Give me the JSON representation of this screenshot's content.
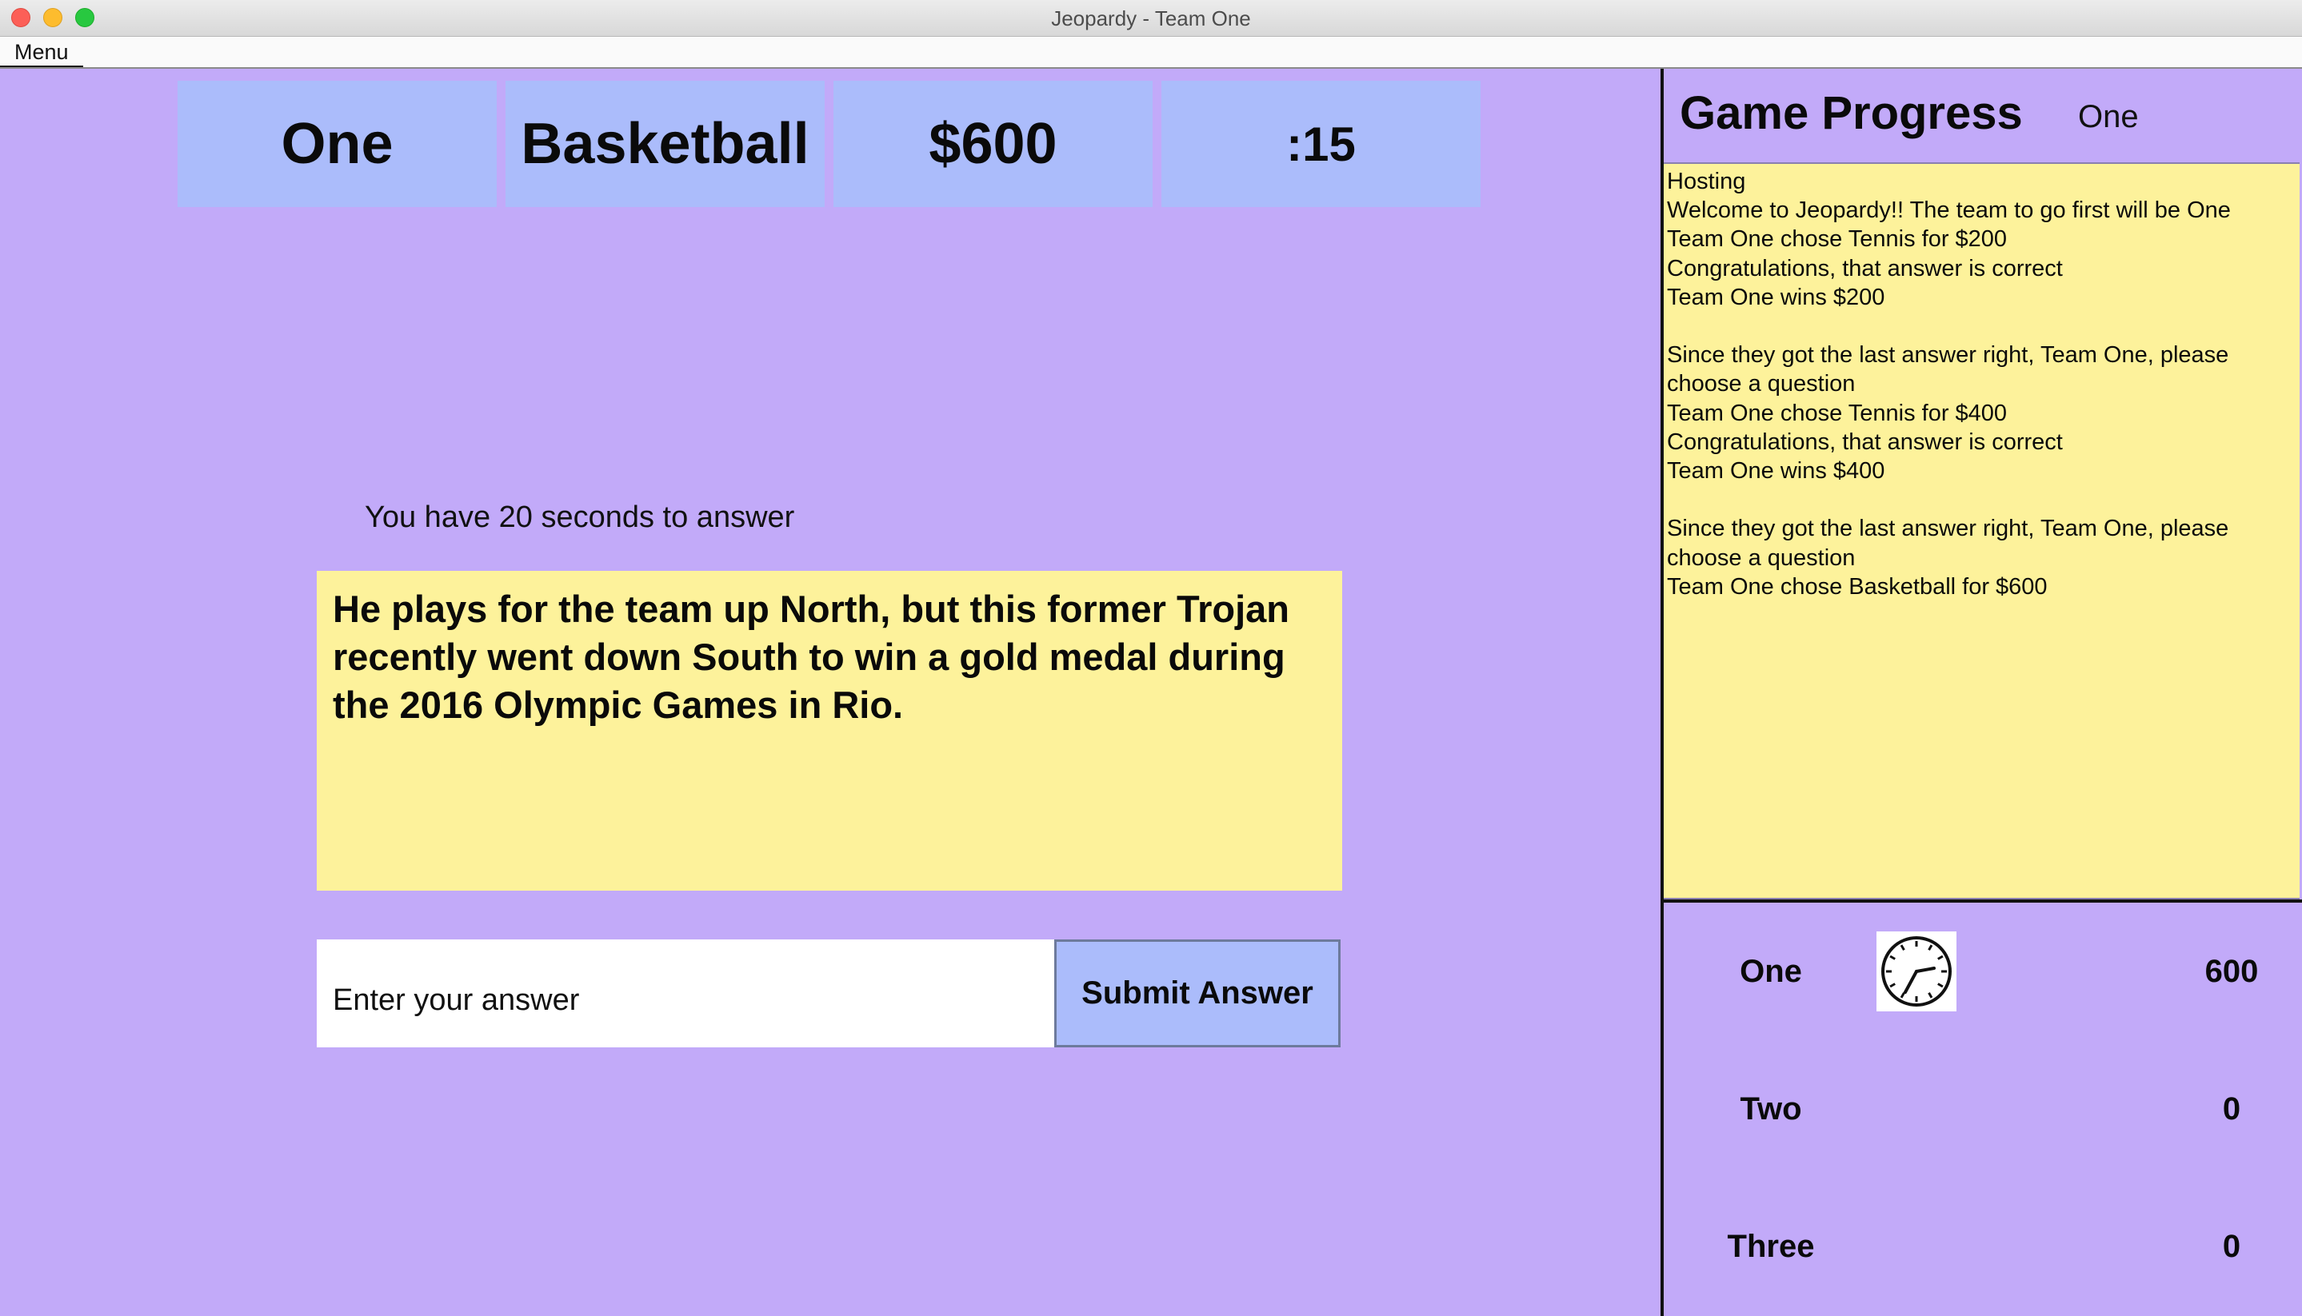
{
  "window": {
    "title": "Jeopardy - Team One"
  },
  "menubar": {
    "menu_label": "Menu"
  },
  "current_question": {
    "team": "One",
    "category": "Basketball",
    "value": "$600",
    "timer": ":15",
    "time_message": "You have 20 seconds to answer",
    "question_text": "He plays for the team up North, but this former Trojan recently went down South to win a gold medal during the 2016 Olympic Games in Rio."
  },
  "answer": {
    "placeholder": "Enter your answer",
    "value": "",
    "submit_label": "Submit Answer"
  },
  "progress": {
    "title": "Game Progress",
    "current_team": "One",
    "log": [
      "Hosting",
      "Welcome to Jeopardy!! The team to go first will be One",
      "Team One chose Tennis for $200",
      "Congratulations, that answer is correct",
      "Team One wins $200",
      "",
      "Since they got the last answer right, Team One, please choose a question",
      "Team One chose Tennis for $400",
      "Congratulations, that answer is correct",
      "Team One wins $400",
      "",
      "Since they got the last answer right, Team One, please choose a question",
      "Team One chose Basketball for $600"
    ]
  },
  "scores": [
    {
      "team": "One",
      "score": "600",
      "active": true,
      "icon": "clock-icon"
    },
    {
      "team": "Two",
      "score": "0",
      "active": false
    },
    {
      "team": "Three",
      "score": "0",
      "active": false
    }
  ],
  "colors": {
    "background": "#c2aaf9",
    "header_cell": "#abbcfb",
    "question_box": "#fdf29b",
    "log_box": "#fdf29b",
    "button": "#abbcfb"
  }
}
